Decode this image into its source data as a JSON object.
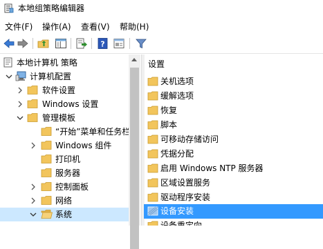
{
  "window": {
    "title": "本地组策略编辑器"
  },
  "menu": [
    "文件(F)",
    "操作(A)",
    "查看(V)",
    "帮助(H)"
  ],
  "toolbar": {
    "buttons": [
      "back-icon",
      "forward-icon",
      "up-folder-icon",
      "show-hide-tree-icon",
      "export-list-icon",
      "help-icon",
      "properties-icon",
      "filter-icon"
    ]
  },
  "tree": {
    "items": [
      {
        "label": "本地计算机 策略",
        "icon": "computer-policy-icon",
        "expand": "none"
      },
      {
        "label": "计算机配置",
        "icon": "computer-icon",
        "expand": "expanded"
      },
      {
        "label": "软件设置",
        "icon": "folder-icon",
        "expand": "collapsed"
      },
      {
        "label": "Windows 设置",
        "icon": "folder-icon",
        "expand": "collapsed"
      },
      {
        "label": "管理模板",
        "icon": "folder-icon",
        "expand": "expanded"
      },
      {
        "label": "“开始”菜单和任务栏",
        "icon": "folder-icon",
        "expand": "none"
      },
      {
        "label": "Windows 组件",
        "icon": "folder-icon",
        "expand": "collapsed"
      },
      {
        "label": "打印机",
        "icon": "folder-icon",
        "expand": "none"
      },
      {
        "label": "服务器",
        "icon": "folder-icon",
        "expand": "none"
      },
      {
        "label": "控制面板",
        "icon": "folder-icon",
        "expand": "collapsed"
      },
      {
        "label": "网络",
        "icon": "folder-icon",
        "expand": "collapsed"
      },
      {
        "label": "系统",
        "icon": "folder-icon",
        "expand": "expanded"
      }
    ]
  },
  "list": {
    "header": "设置",
    "items": [
      "关机选项",
      "缓解选项",
      "恢复",
      "脚本",
      "可移动存储访问",
      "凭据分配",
      "启用 Windows NTP 服务器",
      "区域设置服务",
      "驱动程序安装",
      "设备安装",
      "设备重定向"
    ]
  },
  "colors": {
    "list_selection": "#3399ff",
    "tree_selection": "#cce8ff",
    "folder": "#f2c55c",
    "scrollbar_thumb": "#c2c2c2"
  }
}
